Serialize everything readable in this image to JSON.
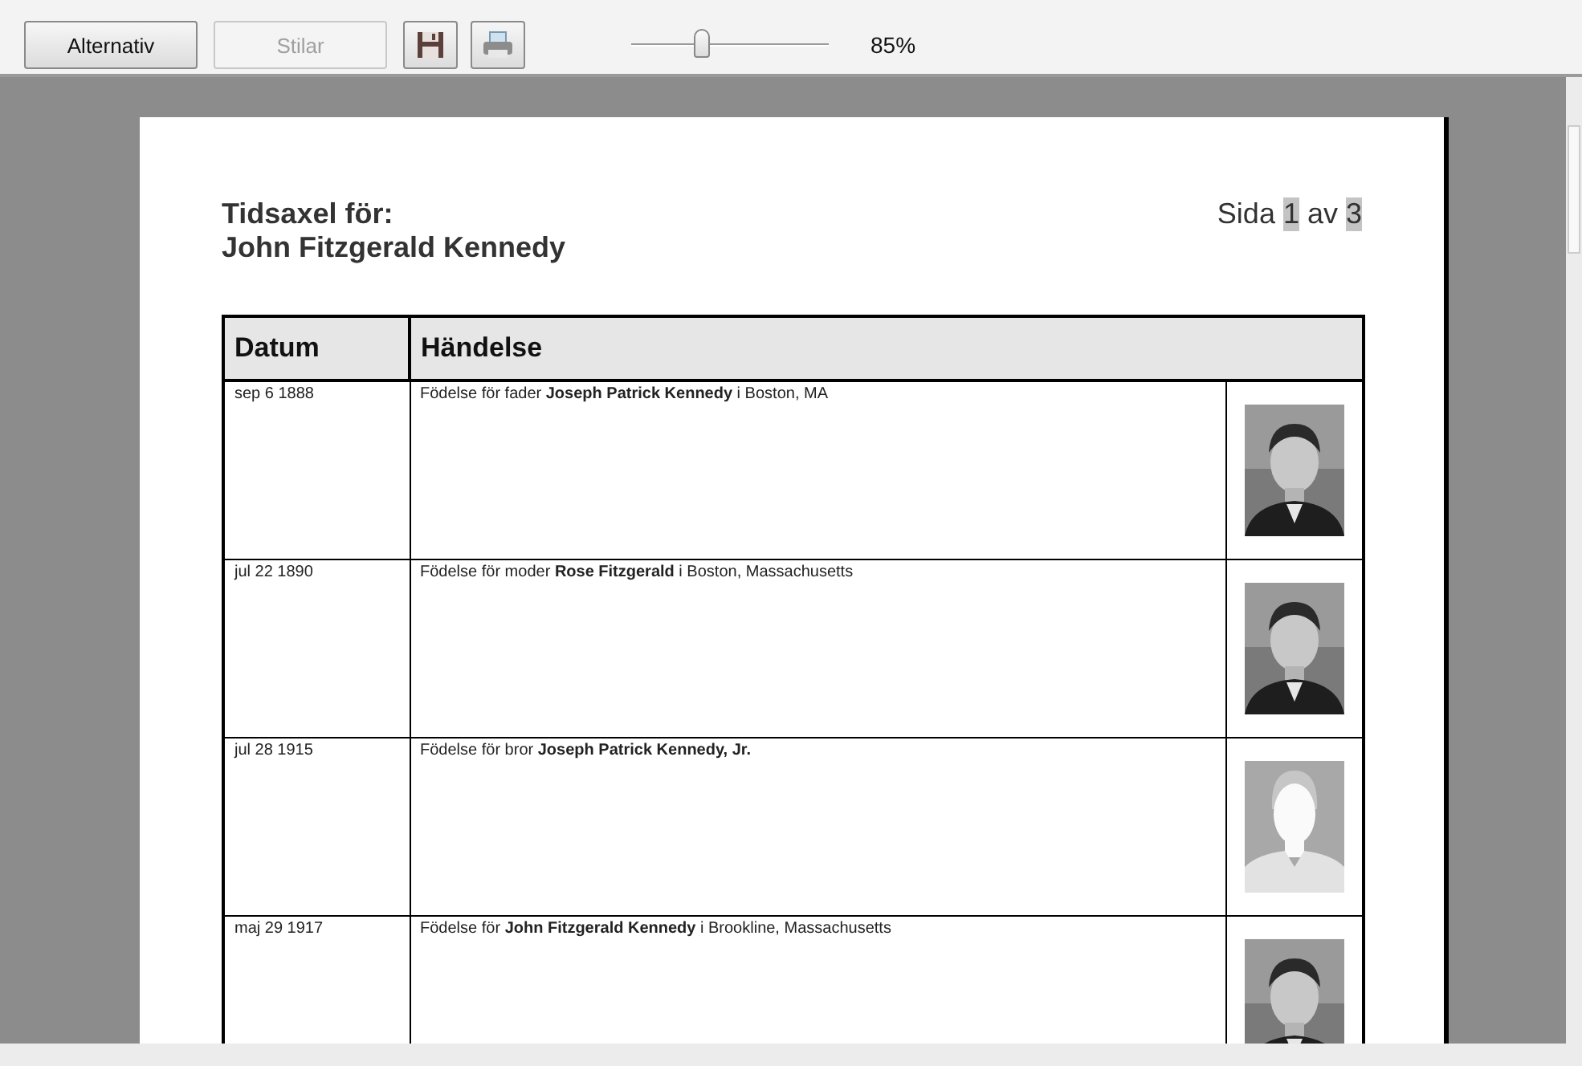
{
  "toolbar": {
    "buttons": [
      {
        "label": "Alternativ",
        "disabled": false
      },
      {
        "label": "Stilar",
        "disabled": true
      }
    ],
    "zoom": {
      "level": 0.36,
      "reading": "85%"
    }
  },
  "page": {
    "title": "Tidsaxel för:",
    "subject": "John Fitzgerald Kennedy",
    "page_label": "Sida",
    "page_number": "1",
    "page_of": "av",
    "page_total": "3",
    "table": {
      "columns": [
        "Datum",
        "Händelse"
      ],
      "rows": [
        {
          "date": "sep 6 1888",
          "event": "Födelse för fader **Joseph Patrick Kennedy** i Boston, MA"
        },
        {
          "date": "jul 22 1890",
          "event": "Födelse för moder **Rose Fitzgerald** i Boston, Massachusetts"
        },
        {
          "date": "jul 28 1915",
          "event": "Födelse för bror **Joseph Patrick Kennedy, Jr.**",
          "photo": {
            "kind": "placeholder"
          }
        },
        {
          "date": "maj 29 1917",
          "event": "Födelse för **John Fitzgerald Kennedy** i Brookline, Massachusetts"
        }
      ]
    }
  }
}
